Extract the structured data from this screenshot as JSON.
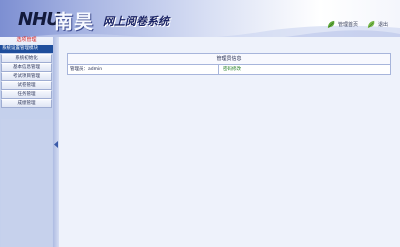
{
  "header": {
    "logo_latin": "NHU",
    "logo_cn": "南昊",
    "system_title": "网上阅卷系统",
    "links": [
      {
        "label": "管理首页",
        "icon": "home-leaf-icon"
      },
      {
        "label": "退出",
        "icon": "exit-icon"
      }
    ]
  },
  "sidebar": {
    "header_label": "选项管理",
    "current_label": "系统设置管理模块",
    "items": [
      {
        "label": "系统初始化"
      },
      {
        "label": "基本信息管理"
      },
      {
        "label": "考试项目管理"
      },
      {
        "label": "试卷管理"
      },
      {
        "label": "任务管理"
      },
      {
        "label": "成绩管理"
      }
    ]
  },
  "main": {
    "panel_title": "管理员信息",
    "admin_label": "管理员：admin",
    "change_password": "密码修改"
  },
  "colors": {
    "current_bg": "#1f4e9c",
    "header_label": "#d42020",
    "link_green": "#1f7a1f"
  }
}
